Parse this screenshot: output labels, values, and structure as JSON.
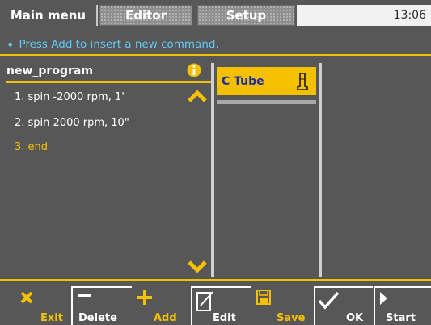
{
  "tabs": [
    {
      "label": "Main menu"
    },
    {
      "label": "Editor"
    },
    {
      "label": "Setup"
    }
  ],
  "clock": "13:06",
  "info_message": "Press Add to insert a new command.",
  "program": {
    "name": "new_program",
    "lines": [
      "1. spin -2000 rpm, 1\"",
      "2. spin 2000 rpm, 10\"",
      "3. end"
    ]
  },
  "tube": {
    "label": "C Tube"
  },
  "toolbar": {
    "exit": "Exit",
    "delete": "Delete",
    "add": "Add",
    "edit": "Edit",
    "save": "Save",
    "ok": "OK",
    "start": "Start"
  },
  "colors": {
    "accent": "#f5c000",
    "background": "#575757",
    "info_text": "#62c9f3",
    "tube_text": "#1a2ea8"
  }
}
